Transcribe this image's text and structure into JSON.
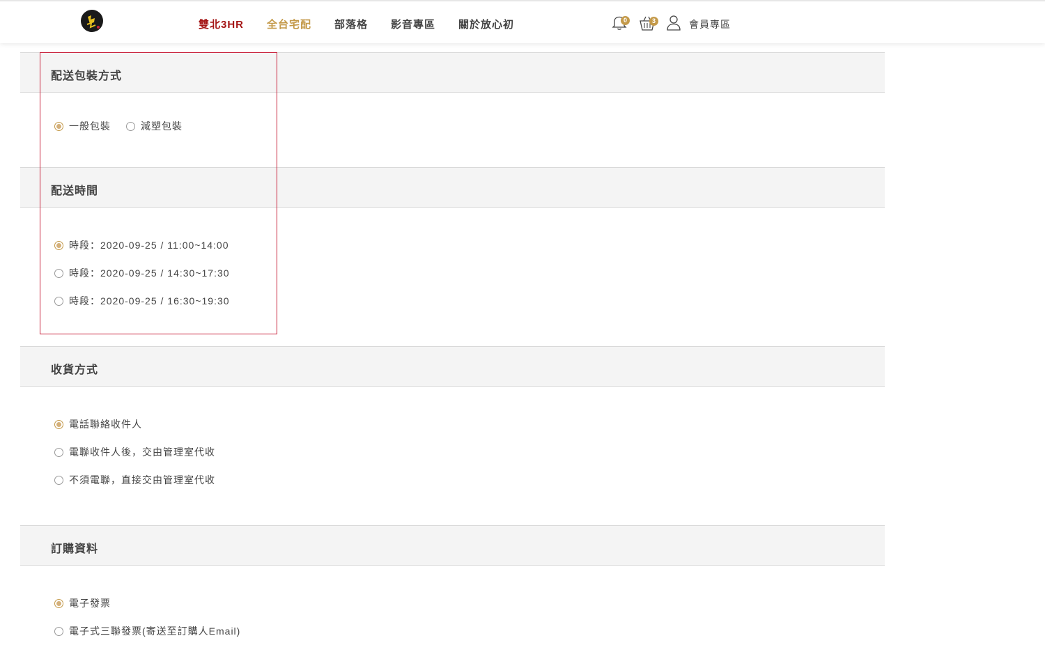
{
  "header": {
    "nav": [
      {
        "label": "雙北3HR"
      },
      {
        "label": "全台宅配"
      },
      {
        "label": "部落格"
      },
      {
        "label": "影音專區"
      },
      {
        "label": "關於放心初"
      }
    ],
    "notification_count": "0",
    "cart_count": "3",
    "member_label": "會員專區",
    "colors": {
      "accent_red": "#a51616",
      "accent_gold": "#c49a4a",
      "highlight_box": "#c8203a"
    }
  },
  "packaging": {
    "title": "配送包裝方式",
    "options": [
      {
        "label": "一般包裝",
        "selected": true
      },
      {
        "label": "減塑包裝",
        "selected": false
      }
    ]
  },
  "delivery_time": {
    "title": "配送時間",
    "options": [
      {
        "label": "時段：2020-09-25 / 11:00~14:00",
        "selected": true
      },
      {
        "label": "時段：2020-09-25 / 14:30~17:30",
        "selected": false
      },
      {
        "label": "時段：2020-09-25 / 16:30~19:30",
        "selected": false
      }
    ]
  },
  "receiving": {
    "title": "收貨方式",
    "options": [
      {
        "label": "電話聯絡收件人",
        "selected": true
      },
      {
        "label": "電聯收件人後，交由管理室代收",
        "selected": false
      },
      {
        "label": "不須電聯，直接交由管理室代收",
        "selected": false
      }
    ]
  },
  "order_info": {
    "title": "訂購資料",
    "options": [
      {
        "label": "電子發票",
        "selected": true
      },
      {
        "label": "電子式三聯發票(寄送至訂購人Email)",
        "selected": false
      }
    ]
  }
}
